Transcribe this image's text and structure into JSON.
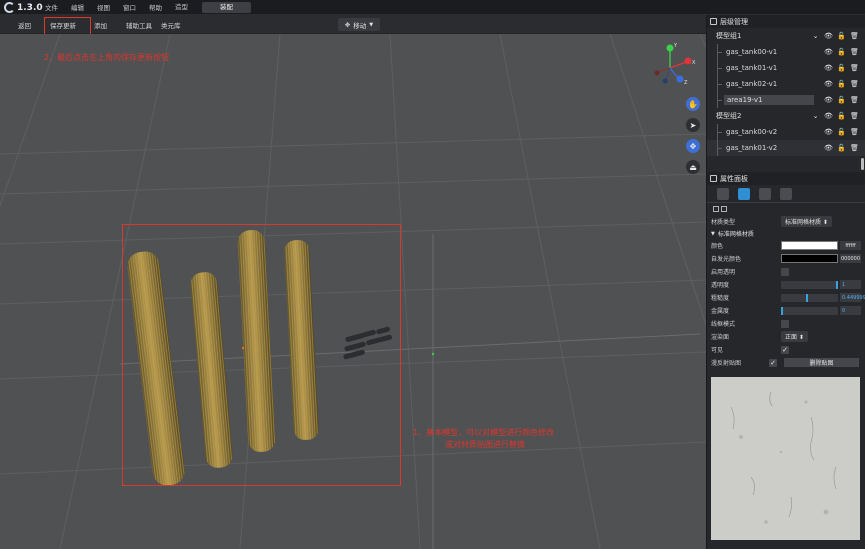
{
  "app": {
    "logo_text": "1.3.0",
    "menu": [
      "文件",
      "编辑",
      "视图",
      "窗口",
      "帮助"
    ],
    "mode_tabs": [
      "造型",
      "装配"
    ],
    "active_mode": "装配"
  },
  "toolbar": {
    "back": "返回",
    "save_update": "保存更新",
    "add": "添加",
    "aux_tools": "辅助工具",
    "component_lib": "类元库",
    "transform_mode": "移动"
  },
  "viewport": {
    "annotation_save": "2、最后点击左上角的保存更新按钮",
    "annotation_select_line1": "1、基本模型，可以对模型进行颜色修改",
    "annotation_select_line2": "或对材质贴图进行替换",
    "gizmo_axes": [
      "Y",
      "X",
      "Z"
    ]
  },
  "layer_panel": {
    "title": "层级管理",
    "groups": [
      {
        "name": "模型组1",
        "children": [
          "gas_tank00-v1",
          "gas_tank01-v1",
          "gas_tank02-v1",
          "area19-v1"
        ]
      },
      {
        "name": "模型组2",
        "children": [
          "gas_tank00-v2",
          "gas_tank01-v2"
        ]
      }
    ],
    "selected": "area19-v1"
  },
  "property_panel": {
    "title": "属性面板",
    "material_type_label": "材质类型",
    "material_type_value": "标准网格材质",
    "section_title": "标准网格材质",
    "color_label": "颜色",
    "color_hex": "ffffff",
    "emissive_label": "自发光颜色",
    "emissive_hex": "000000",
    "transparent_label": "启用透明",
    "opacity_label": "透明度",
    "opacity_value": "1",
    "roughness_label": "粗糙度",
    "roughness_value": "0.449999",
    "metalness_label": "金属度",
    "metalness_value": "0",
    "wireframe_label": "线框模式",
    "side_label": "渲染面",
    "side_value": "正面",
    "visible_label": "可见",
    "diffuse_map_label": "漫反射贴图",
    "remove_map_button": "删除贴图"
  },
  "colors": {
    "accent_red": "#d8382e",
    "active_blue": "#3e6fd6",
    "viewport_bg": "#505153",
    "panel_bg": "#26272b"
  }
}
